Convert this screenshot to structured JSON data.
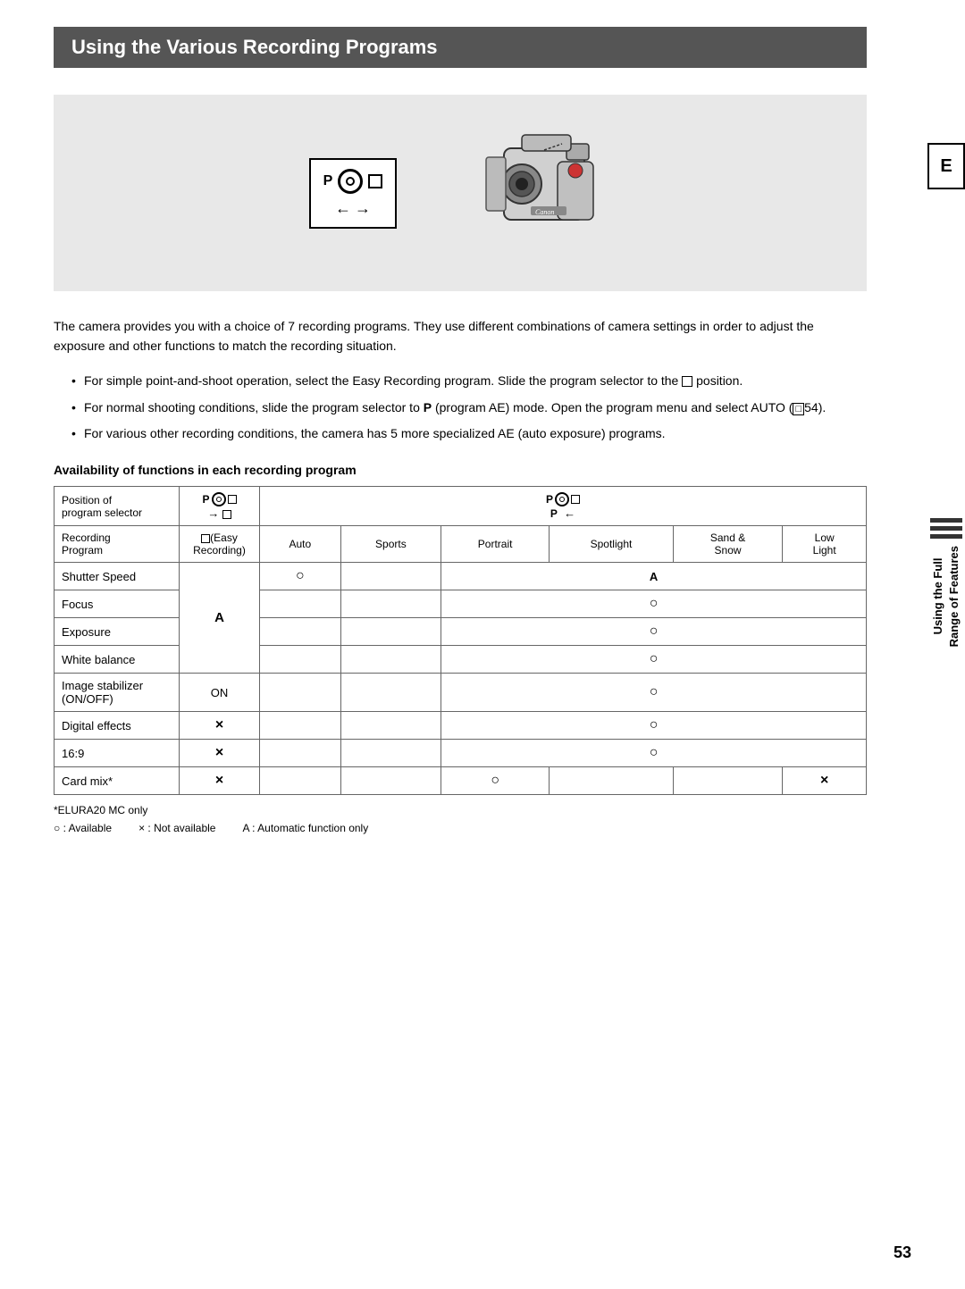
{
  "page": {
    "title": "Using the Various Recording Programs",
    "tab_e": "E",
    "sidebar": {
      "lines_count": 3,
      "vertical_text_line1": "Using the Full",
      "vertical_text_line2": "Range of Features"
    },
    "intro_paragraph": "The camera provides you with a choice of 7 recording programs. They use different combinations of camera settings in order to adjust the exposure and other functions to match the recording situation.",
    "bullets": [
      "For simple point-and-shoot operation, select the Easy Recording program. Slide the program selector to the □ position.",
      "For normal shooting conditions, slide the program selector to P (program AE) mode. Open the program menu and select AUTO (□54).",
      "For various other recording conditions, the camera has 5 more specialized AE (auto exposure) programs."
    ],
    "table_heading": "Availability of functions in each recording program",
    "table": {
      "header_row1": {
        "col1_label": "Position of\nprogram selector",
        "col2_icons": "P dial □ → □",
        "col3_icons": "P dial □ P ←",
        "col_last": ""
      },
      "header_row2": {
        "col1_label": "Recording\nProgram",
        "col2": "□(Easy\nRecording)",
        "col3": "Auto",
        "col4": "Sports",
        "col5": "Portrait",
        "col6": "Spotlight",
        "col7": "Sand &\nSnow",
        "col8": "Low\nLight"
      },
      "rows": [
        {
          "label": "Shutter Speed",
          "col2": "A",
          "col3": "○",
          "col4": "",
          "col5": "A",
          "col6": "",
          "col7": "",
          "col8": ""
        },
        {
          "label": "Focus",
          "col2": "A",
          "col3": "",
          "col4": "",
          "col5": "○",
          "col6": "",
          "col7": "",
          "col8": ""
        },
        {
          "label": "Exposure",
          "col2": "A",
          "col3": "",
          "col4": "",
          "col5": "○",
          "col6": "",
          "col7": "",
          "col8": ""
        },
        {
          "label": "White balance",
          "col2": "A",
          "col3": "",
          "col4": "",
          "col5": "○",
          "col6": "",
          "col7": "",
          "col8": ""
        },
        {
          "label": "Image stabilizer (ON/OFF)",
          "col2": "ON",
          "col3": "",
          "col4": "",
          "col5": "○",
          "col6": "",
          "col7": "",
          "col8": ""
        },
        {
          "label": "Digital effects",
          "col2": "×",
          "col3": "",
          "col4": "",
          "col5": "○",
          "col6": "",
          "col7": "",
          "col8": ""
        },
        {
          "label": "16:9",
          "col2": "×",
          "col3": "",
          "col4": "",
          "col5": "○",
          "col6": "",
          "col7": "",
          "col8": ""
        },
        {
          "label": "Card mix*",
          "col2": "×",
          "col3": "",
          "col4": "",
          "col5": "○",
          "col6": "",
          "col7": "",
          "col8": "×"
        }
      ]
    },
    "footnote1": "*ELURA20 MC only",
    "legend": [
      "○ : Available",
      "× : Not available",
      "A : Automatic function only"
    ],
    "page_number": "53"
  }
}
